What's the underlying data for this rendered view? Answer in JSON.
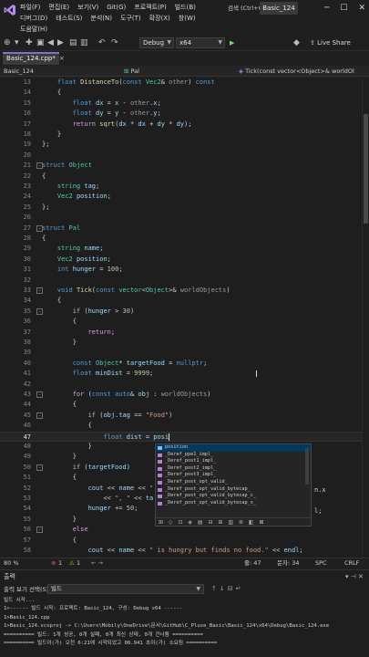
{
  "titlebar": {
    "menu_row1": [
      "파일(F)",
      "편집(E)",
      "보기(V)",
      "Git(G)",
      "프로젝트(P)",
      "빌드(B)"
    ],
    "menu_row2": [
      "디버그(D)",
      "테스트(S)",
      "분석(N)",
      "도구(T)",
      "확장(X)",
      "창(W)"
    ],
    "menu_row3": [
      "도움말(H)"
    ],
    "search_placeholder": "검색 (Ctrl+Q)",
    "solution_name": "Basic_124",
    "min_glyph": "─",
    "max_glyph": "☐",
    "close_glyph": "✕"
  },
  "toolbar": {
    "config": "Debug",
    "platform": "x64",
    "run_label": "",
    "liveshare": "Live Share"
  },
  "tab": {
    "file_name": "Basic_124.cpp*",
    "close": "×"
  },
  "navbar": {
    "project": "Basic_124",
    "scope": "Pal",
    "member": "Tick(const vector<Object>& worldOl"
  },
  "editor": {
    "current_line": 47,
    "lines": [
      {
        "n": 13,
        "fold": "",
        "code": [
          [
            "    ",
            ""
          ],
          [
            "float ",
            "kw"
          ],
          [
            "DistanceTo",
            "fn"
          ],
          [
            "(",
            ""
          ],
          [
            "const ",
            "kw"
          ],
          [
            "Vec2",
            "ty"
          ],
          [
            "& ",
            ""
          ],
          [
            "other",
            "prm"
          ],
          [
            ") ",
            ""
          ],
          [
            "const",
            "kw"
          ]
        ]
      },
      {
        "n": 14,
        "fold": "",
        "code": [
          [
            "    {",
            ""
          ]
        ]
      },
      {
        "n": 15,
        "fold": "",
        "code": [
          [
            "        ",
            ""
          ],
          [
            "float ",
            "kw"
          ],
          [
            "dx ",
            "var"
          ],
          [
            "= ",
            ""
          ],
          [
            "x ",
            "var"
          ],
          [
            "- ",
            ""
          ],
          [
            "other",
            "prm"
          ],
          [
            ".",
            ""
          ],
          [
            "x",
            "var"
          ],
          [
            ";",
            ""
          ]
        ]
      },
      {
        "n": 16,
        "fold": "",
        "code": [
          [
            "        ",
            ""
          ],
          [
            "float ",
            "kw"
          ],
          [
            "dy ",
            "var"
          ],
          [
            "= ",
            ""
          ],
          [
            "y ",
            "var"
          ],
          [
            "- ",
            ""
          ],
          [
            "other",
            "prm"
          ],
          [
            ".",
            ""
          ],
          [
            "y",
            "var"
          ],
          [
            ";",
            ""
          ]
        ]
      },
      {
        "n": 17,
        "fold": "",
        "code": [
          [
            "        ",
            ""
          ],
          [
            "return ",
            "kw2"
          ],
          [
            "sqrt",
            "fn"
          ],
          [
            "(",
            ""
          ],
          [
            "dx ",
            "var"
          ],
          [
            "* ",
            ""
          ],
          [
            "dx ",
            "var"
          ],
          [
            "+ ",
            ""
          ],
          [
            "dy ",
            "var"
          ],
          [
            "* ",
            ""
          ],
          [
            "dy",
            "var"
          ],
          [
            ");",
            ""
          ]
        ]
      },
      {
        "n": 18,
        "fold": "",
        "code": [
          [
            "    }",
            ""
          ]
        ]
      },
      {
        "n": 19,
        "fold": "",
        "code": [
          [
            "};",
            ""
          ]
        ]
      },
      {
        "n": 20,
        "fold": "",
        "code": [
          [
            "",
            ""
          ]
        ]
      },
      {
        "n": 21,
        "fold": "-",
        "code": [
          [
            "struct ",
            "kw"
          ],
          [
            "Object",
            "ty"
          ]
        ]
      },
      {
        "n": 22,
        "fold": "",
        "code": [
          [
            "{",
            ""
          ]
        ]
      },
      {
        "n": 23,
        "fold": "",
        "code": [
          [
            "    ",
            ""
          ],
          [
            "string ",
            "ty"
          ],
          [
            "tag",
            "var"
          ],
          [
            ";",
            ""
          ]
        ]
      },
      {
        "n": 24,
        "fold": "",
        "code": [
          [
            "    ",
            ""
          ],
          [
            "Vec2 ",
            "ty"
          ],
          [
            "position",
            "var"
          ],
          [
            ";",
            ""
          ]
        ]
      },
      {
        "n": 25,
        "fold": "",
        "code": [
          [
            "};",
            ""
          ]
        ]
      },
      {
        "n": 26,
        "fold": "",
        "code": [
          [
            "",
            ""
          ]
        ]
      },
      {
        "n": 27,
        "fold": "-",
        "code": [
          [
            "struct ",
            "kw"
          ],
          [
            "Pal",
            "ty"
          ]
        ]
      },
      {
        "n": 28,
        "fold": "",
        "code": [
          [
            "{",
            ""
          ]
        ]
      },
      {
        "n": 29,
        "fold": "",
        "code": [
          [
            "    ",
            ""
          ],
          [
            "string ",
            "ty"
          ],
          [
            "name",
            "var"
          ],
          [
            ";",
            ""
          ]
        ]
      },
      {
        "n": 30,
        "fold": "",
        "code": [
          [
            "    ",
            ""
          ],
          [
            "Vec2 ",
            "ty"
          ],
          [
            "position",
            "var"
          ],
          [
            ";",
            ""
          ]
        ]
      },
      {
        "n": 31,
        "fold": "",
        "code": [
          [
            "    ",
            ""
          ],
          [
            "int ",
            "kw"
          ],
          [
            "hunger ",
            "var"
          ],
          [
            "= ",
            ""
          ],
          [
            "100",
            "num"
          ],
          [
            ";",
            ""
          ]
        ]
      },
      {
        "n": 32,
        "fold": "",
        "code": [
          [
            "",
            ""
          ]
        ]
      },
      {
        "n": 33,
        "fold": "-",
        "code": [
          [
            "    ",
            ""
          ],
          [
            "void ",
            "kw"
          ],
          [
            "Tick",
            "fn"
          ],
          [
            "(",
            ""
          ],
          [
            "const ",
            "kw"
          ],
          [
            "vector",
            "ty"
          ],
          [
            "<",
            ""
          ],
          [
            "Object",
            "ty"
          ],
          [
            ">& ",
            ""
          ],
          [
            "worldObjects",
            "prm"
          ],
          [
            ")",
            ""
          ]
        ]
      },
      {
        "n": 34,
        "fold": "",
        "code": [
          [
            "    {",
            ""
          ]
        ]
      },
      {
        "n": 35,
        "fold": "-",
        "code": [
          [
            "        ",
            ""
          ],
          [
            "if ",
            "kw2"
          ],
          [
            "(",
            ""
          ],
          [
            "hunger ",
            "var"
          ],
          [
            "> ",
            ""
          ],
          [
            "30",
            "num"
          ],
          [
            ")",
            ""
          ]
        ]
      },
      {
        "n": 36,
        "fold": "",
        "code": [
          [
            "        {",
            ""
          ]
        ]
      },
      {
        "n": 37,
        "fold": "",
        "code": [
          [
            "            ",
            ""
          ],
          [
            "return",
            "kw2"
          ],
          [
            ";",
            ""
          ]
        ]
      },
      {
        "n": 38,
        "fold": "",
        "code": [
          [
            "        }",
            ""
          ]
        ]
      },
      {
        "n": 39,
        "fold": "",
        "code": [
          [
            "",
            ""
          ]
        ]
      },
      {
        "n": 40,
        "fold": "",
        "code": [
          [
            "        ",
            ""
          ],
          [
            "const ",
            "kw"
          ],
          [
            "Object",
            "ty"
          ],
          [
            "* ",
            ""
          ],
          [
            "targetFood ",
            "var"
          ],
          [
            "= ",
            ""
          ],
          [
            "nullptr",
            "kw"
          ],
          [
            ";",
            ""
          ]
        ]
      },
      {
        "n": 41,
        "fold": "",
        "code": [
          [
            "        ",
            ""
          ],
          [
            "float ",
            "kw"
          ],
          [
            "minDist ",
            "var"
          ],
          [
            "= ",
            ""
          ],
          [
            "9999",
            "num"
          ],
          [
            ";",
            ""
          ]
        ]
      },
      {
        "n": 42,
        "fold": "",
        "code": [
          [
            "",
            ""
          ]
        ]
      },
      {
        "n": 43,
        "fold": "-",
        "code": [
          [
            "        ",
            ""
          ],
          [
            "for ",
            "kw2"
          ],
          [
            "(",
            ""
          ],
          [
            "const ",
            "kw"
          ],
          [
            "auto",
            "kw"
          ],
          [
            "& ",
            ""
          ],
          [
            "obj ",
            "var"
          ],
          [
            ": ",
            ""
          ],
          [
            "worldObjects",
            "prm"
          ],
          [
            ")",
            ""
          ]
        ]
      },
      {
        "n": 44,
        "fold": "",
        "code": [
          [
            "        {",
            ""
          ]
        ]
      },
      {
        "n": 45,
        "fold": "-",
        "code": [
          [
            "            ",
            ""
          ],
          [
            "if ",
            "kw2"
          ],
          [
            "(",
            ""
          ],
          [
            "obj",
            "var"
          ],
          [
            ".",
            ""
          ],
          [
            "tag ",
            "var"
          ],
          [
            "== ",
            ""
          ],
          [
            "\"Food\"",
            "str"
          ],
          [
            ")",
            ""
          ]
        ]
      },
      {
        "n": 46,
        "fold": "",
        "code": [
          [
            "            {",
            ""
          ]
        ]
      },
      {
        "n": 47,
        "fold": "",
        "code": [
          [
            "                ",
            ""
          ],
          [
            "float ",
            "kw"
          ],
          [
            "dist ",
            "var"
          ],
          [
            "= ",
            ""
          ],
          [
            "posi",
            "var"
          ]
        ]
      },
      {
        "n": 48,
        "fold": "",
        "code": [
          [
            "            }",
            ""
          ]
        ]
      },
      {
        "n": 49,
        "fold": "",
        "code": [
          [
            "        }",
            ""
          ]
        ]
      },
      {
        "n": 50,
        "fold": "-",
        "code": [
          [
            "        ",
            ""
          ],
          [
            "if ",
            "kw2"
          ],
          [
            "(",
            ""
          ],
          [
            "targetFood",
            "var"
          ],
          [
            ")",
            ""
          ]
        ]
      },
      {
        "n": 51,
        "fold": "",
        "code": [
          [
            "        {",
            ""
          ]
        ]
      },
      {
        "n": 52,
        "fold": "",
        "code": [
          [
            "            ",
            ""
          ],
          [
            "cout ",
            "var"
          ],
          [
            "<< ",
            ""
          ],
          [
            "name ",
            "var"
          ],
          [
            "<< ",
            ""
          ],
          [
            "\"",
            "str"
          ]
        ]
      },
      {
        "n": 53,
        "fold": "",
        "code": [
          [
            "                ",
            ""
          ],
          [
            "<< ",
            ""
          ],
          [
            "\", \" ",
            "str"
          ],
          [
            "<< ",
            ""
          ],
          [
            "ta",
            "var"
          ]
        ]
      },
      {
        "n": 54,
        "fold": "",
        "code": [
          [
            "            ",
            ""
          ],
          [
            "hunger ",
            "var"
          ],
          [
            "+= ",
            ""
          ],
          [
            "50",
            "num"
          ],
          [
            ";",
            ""
          ]
        ]
      },
      {
        "n": 55,
        "fold": "",
        "code": [
          [
            "        }",
            ""
          ]
        ]
      },
      {
        "n": 56,
        "fold": "-",
        "code": [
          [
            "        ",
            ""
          ],
          [
            "else",
            "kw2"
          ]
        ]
      },
      {
        "n": 57,
        "fold": "",
        "code": [
          [
            "        {",
            ""
          ]
        ]
      },
      {
        "n": 58,
        "fold": "",
        "code": [
          [
            "            ",
            ""
          ],
          [
            "cout ",
            "var"
          ],
          [
            "<< ",
            ""
          ],
          [
            "name ",
            "var"
          ],
          [
            "<< ",
            ""
          ],
          [
            "\" is hungry but finds no food.\" ",
            "str"
          ],
          [
            "<< ",
            ""
          ],
          [
            "endl",
            "var"
          ],
          [
            ";",
            ""
          ]
        ]
      }
    ],
    "line52_tail": "n.x",
    "line54_tail": "l;"
  },
  "intellisense": {
    "items": [
      "position",
      "_Deref_ppe1_impl_",
      "_Deref_post1_impl_",
      "_Deref_post2_impl_",
      "_Deref_post3_impl_",
      "_Deref_post_opt_valid_",
      "_Deref_post_opt_valid_bytecap_",
      "_Deref_post_opt_valid_bytecap_c_",
      "_Deref_post_opt_valid_bytecap_x_"
    ],
    "filters": "⊞ ◇ ⊡ ◈ ▤ ⊟ ⊞ ▥ ⊛ ◧ ⊠"
  },
  "editor_status": {
    "zoom": "80 %",
    "errors": "1",
    "warnings": "1",
    "line": "줄: 47",
    "col": "문자: 34",
    "spc": "SPC",
    "eol": "CRLF"
  },
  "output": {
    "title": "출력",
    "source_label": "출력 보기 선택(S):",
    "source_value": "빌드",
    "lines": [
      "빌드 시작...",
      "1>------ 빌드 시작: 프로젝트: Basic_124, 구성: Debug x64 ------",
      "1>Basic_124.cpp",
      "1>Basic_124.vcxproj -> C:\\Users\\Mobily\\OneDrive\\문서\\GitHub\\C_Pluse_Basic\\Basic_124\\x64\\Debug\\Basic_124.exe",
      "========== 빌드: 1개 성공, 0개 실패, 0개 최신 상태, 0개 건너뜀 ==========",
      "========== 빌드이(가) 오전 6:21에 시작되었고 00.941 초이(가) 소요됨 =========="
    ]
  }
}
